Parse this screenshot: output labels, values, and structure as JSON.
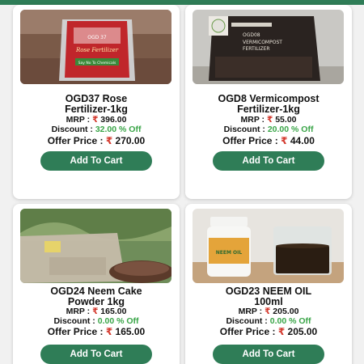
{
  "products": [
    {
      "title_line1": "OGD37 Rose",
      "title_line2": "Fertilizer-1kg",
      "mrp_label": "MRP :",
      "mrp_value": "396.00",
      "discount_label": "Discount :",
      "discount_value": "32.00 % Off",
      "offer_label": "Offer Price :",
      "offer_value": "270.00",
      "button_label": "Add To Cart",
      "image_icon": "fertilizer-bag-image"
    },
    {
      "title_line1": "OGD8 Vermicompost",
      "title_line2": "Fertilizer-1kg",
      "mrp_label": "MRP :",
      "mrp_value": "55.00",
      "discount_label": "Discount :",
      "discount_value": "20.00 % Off",
      "offer_label": "Offer Price :",
      "offer_value": "44.00",
      "button_label": "Add To Cart",
      "image_icon": "vermicompost-bag-image"
    },
    {
      "title_line1": "OGD24 Neem Cake",
      "title_line2": "Powder 1kg",
      "mrp_label": "MRP :",
      "mrp_value": "165.00",
      "discount_label": "Discount :",
      "discount_value": "0.00 % Off",
      "offer_label": "Offer Price :",
      "offer_value": "165.00",
      "button_label": "Add To Cart",
      "image_icon": "neem-cake-powder-image"
    },
    {
      "title_line1": "OGD23 NEEM OIL",
      "title_line2": "100ml",
      "mrp_label": "MRP :",
      "mrp_value": "205.00",
      "discount_label": "Discount :",
      "discount_value": "0.00 % Off",
      "offer_label": "Offer Price :",
      "offer_value": "205.00",
      "button_label": "Add To Cart",
      "image_icon": "neem-oil-bottle-image"
    }
  ],
  "images": {
    "rose_bag_text_1": "OGD 37",
    "rose_bag_text_2": "Rose Fertilizer",
    "rose_bag_text_3": "Say No To Chemicals",
    "vermi_bag_text_1": "OGD08",
    "vermi_bag_text_2": "VERMICOMPOST",
    "vermi_bag_text_3": "FERTILIZER",
    "neem_bottle_text": "NEEM OIL"
  },
  "currency_symbol": "₹",
  "colors": {
    "brand_green": "#2f7d57",
    "rupee_red": "#d43a2f",
    "discount_green": "#3aa548"
  }
}
